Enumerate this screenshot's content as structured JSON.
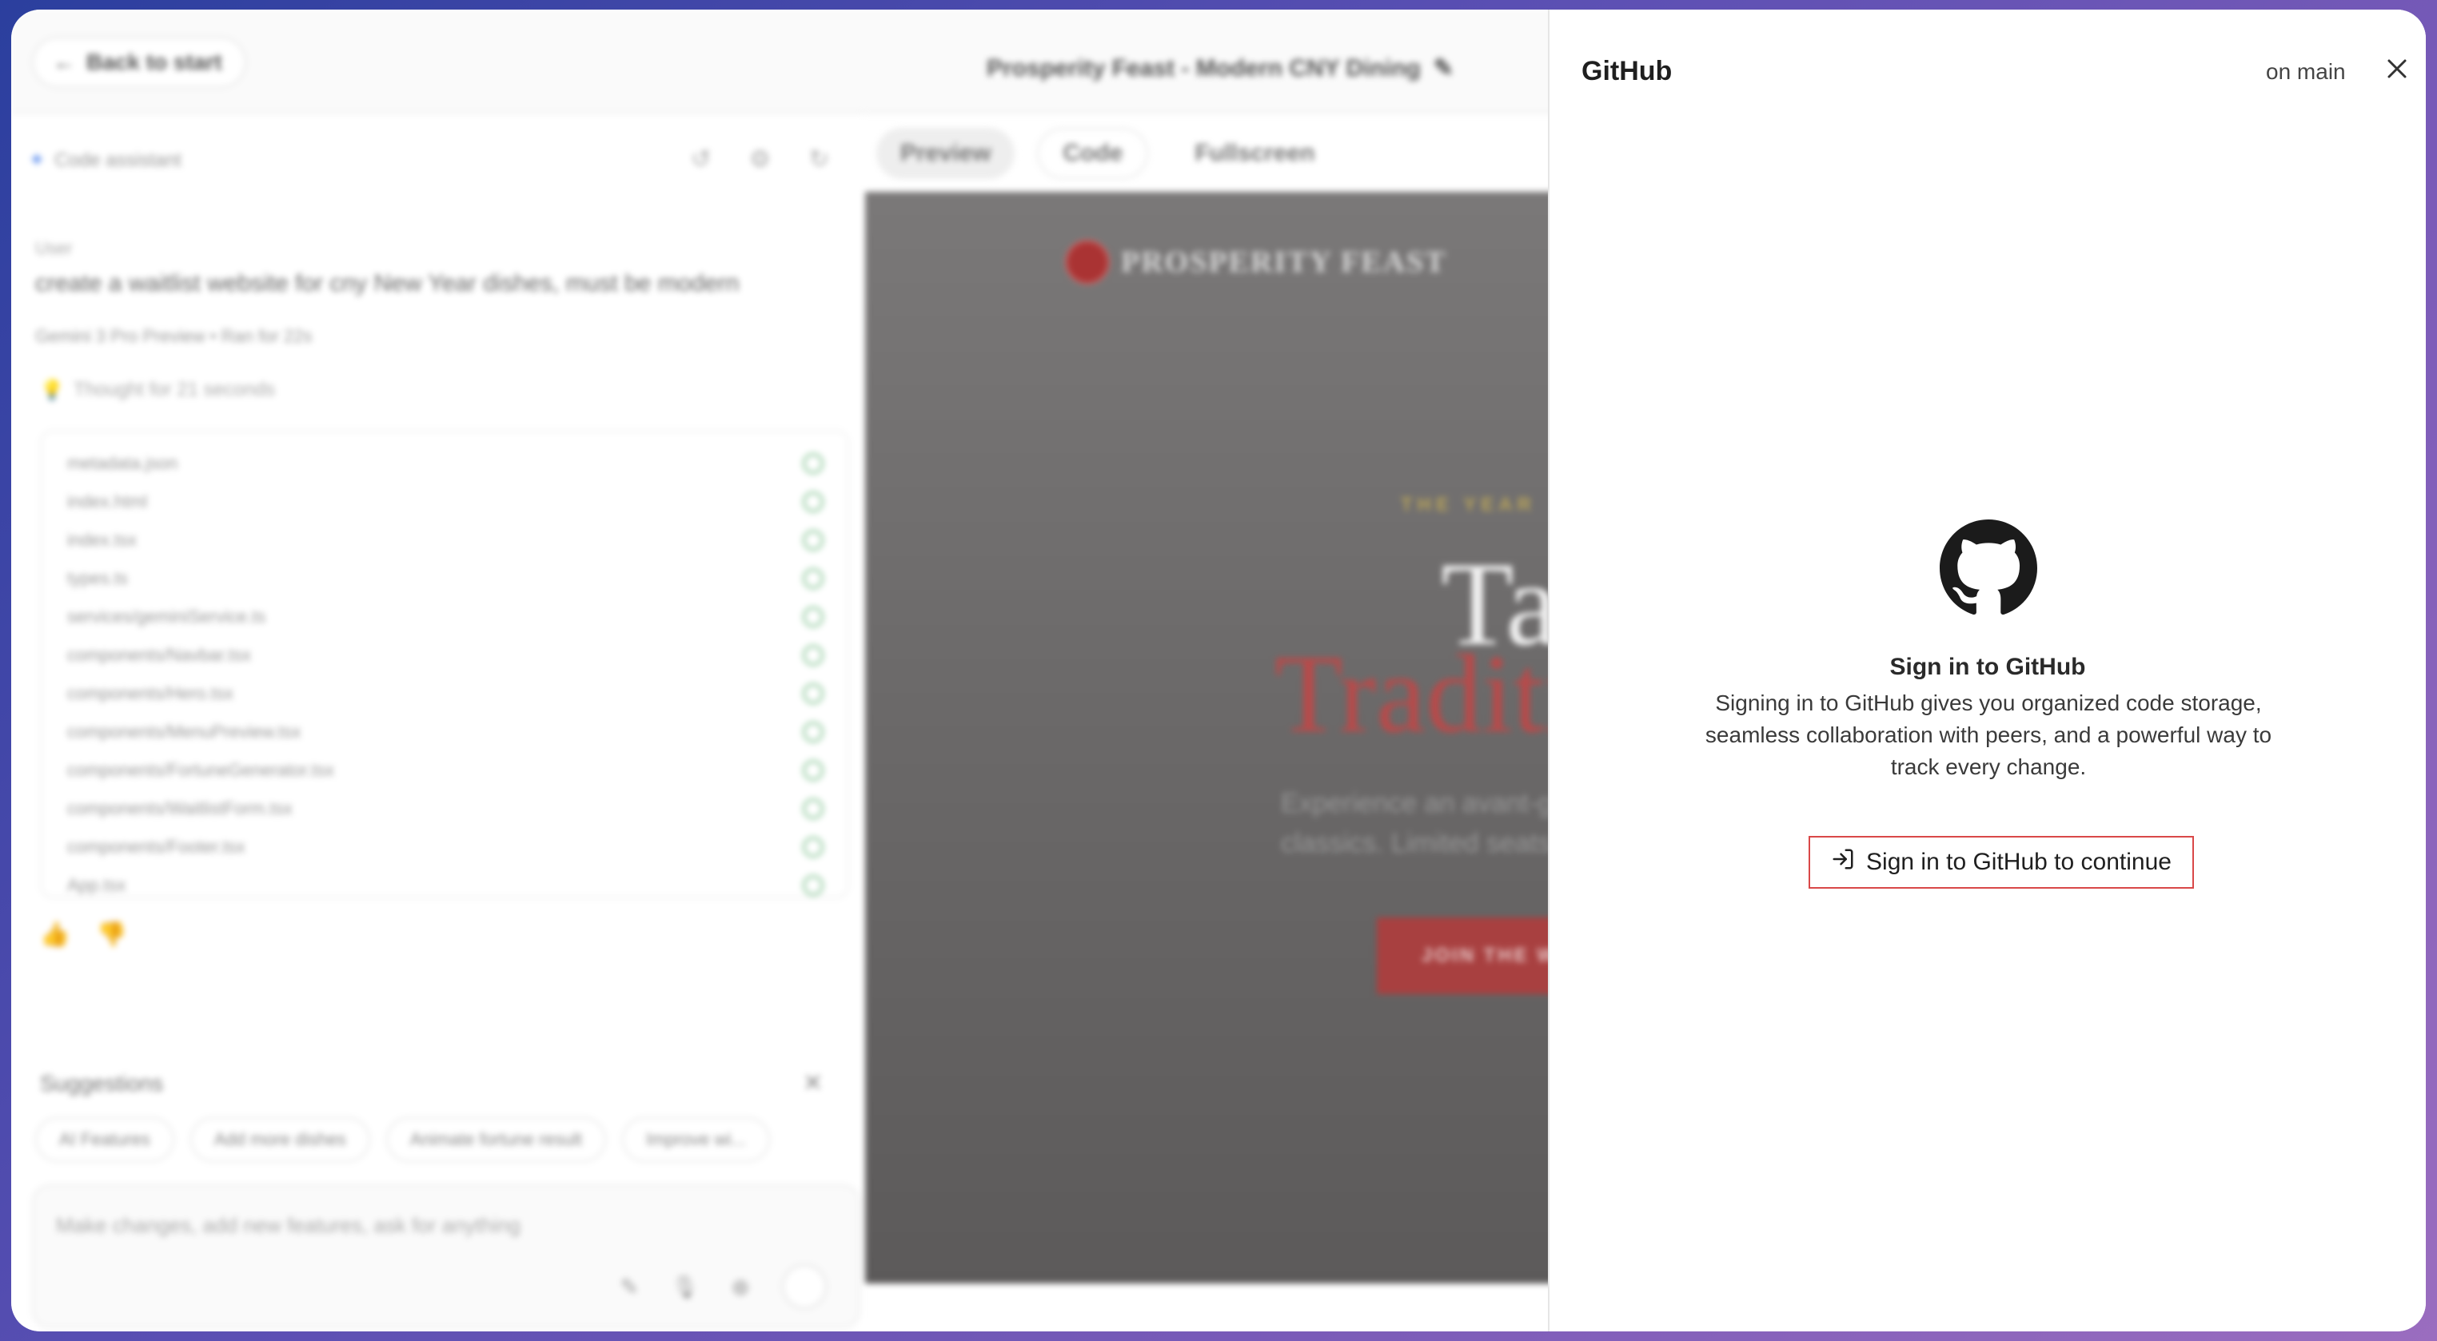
{
  "topbar": {
    "back_label": "Back to start",
    "project_title": "Prosperity Feast - Modern CNY Dining"
  },
  "assistant": {
    "header": "Code assistant",
    "user_label": "User",
    "user_message": "create a waitlist website for cny New Year dishes, must be modern",
    "model_info": "Gemini 3 Pro Preview  •  Ran for 22s",
    "thought": "Thought for 21 seconds",
    "files": [
      "metadata.json",
      "index.html",
      "index.tsx",
      "types.ts",
      "services/geminiService.ts",
      "components/Navbar.tsx",
      "components/Hero.tsx",
      "components/MenuPreview.tsx",
      "components/FortuneGenerator.tsx",
      "components/WaitlistForm.tsx",
      "components/Footer.tsx",
      "App.tsx"
    ]
  },
  "suggestions": {
    "title": "Suggestions",
    "chips": [
      "AI Features",
      "Add more dishes",
      "Animate fortune result",
      "Improve wi..."
    ]
  },
  "composer": {
    "placeholder": "Make changes, add new features, ask for anything"
  },
  "view_tabs": {
    "preview": "Preview",
    "code": "Code",
    "fullscreen": "Fullscreen"
  },
  "preview": {
    "brand": "PROSPERITY FEAST",
    "eyebrow": "THE YEAR",
    "headline_1": "Ta",
    "headline_2": "Traditi",
    "body_1": "Experience an avant-ga",
    "body_2": "classics. Limited seats",
    "cta": "JOIN THE WA"
  },
  "github_panel": {
    "title": "GitHub",
    "branch": "on main",
    "heading": "Sign in to GitHub",
    "description": "Signing in to GitHub gives you organized code storage, seamless collaboration with peers, and a powerful way to track every change.",
    "signin_button": "Sign in to GitHub to continue"
  }
}
